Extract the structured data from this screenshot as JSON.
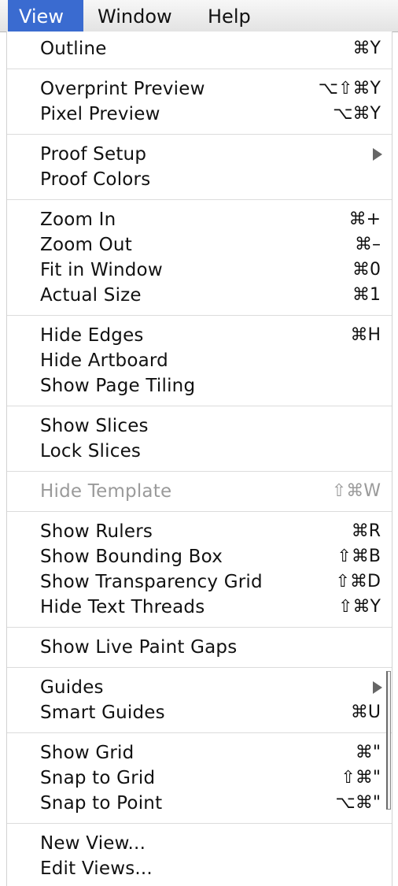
{
  "menubar": {
    "items": [
      {
        "label": "View",
        "active": true
      },
      {
        "label": "Window"
      },
      {
        "label": "Help"
      }
    ]
  },
  "menu": {
    "items": [
      {
        "label": "Outline",
        "shortcut": "⌘Y"
      },
      {
        "label": "Overprint Preview",
        "shortcut": "⌥⇧⌘Y"
      },
      {
        "label": "Pixel Preview",
        "shortcut": "⌥⌘Y"
      },
      {
        "label": "Proof Setup",
        "submenu": true
      },
      {
        "label": "Proof Colors",
        "shortcut": ""
      },
      {
        "label": "Zoom In",
        "shortcut": "⌘+"
      },
      {
        "label": "Zoom Out",
        "shortcut": "⌘–"
      },
      {
        "label": "Fit in Window",
        "shortcut": "⌘0"
      },
      {
        "label": "Actual Size",
        "shortcut": "⌘1"
      },
      {
        "label": "Hide Edges",
        "shortcut": "⌘H"
      },
      {
        "label": "Hide Artboard",
        "shortcut": ""
      },
      {
        "label": "Show Page Tiling",
        "shortcut": ""
      },
      {
        "label": "Show Slices",
        "shortcut": ""
      },
      {
        "label": "Lock Slices",
        "shortcut": ""
      },
      {
        "label": "Hide Template",
        "shortcut": "⇧⌘W",
        "disabled": true
      },
      {
        "label": "Show Rulers",
        "shortcut": "⌘R"
      },
      {
        "label": "Show Bounding Box",
        "shortcut": "⇧⌘B"
      },
      {
        "label": "Show Transparency Grid",
        "shortcut": "⇧⌘D"
      },
      {
        "label": "Hide Text Threads",
        "shortcut": "⇧⌘Y"
      },
      {
        "label": "Show Live Paint Gaps",
        "shortcut": ""
      },
      {
        "label": "Guides",
        "submenu": true
      },
      {
        "label": "Smart Guides",
        "shortcut": "⌘U"
      },
      {
        "label": "Show Grid",
        "shortcut": "⌘\""
      },
      {
        "label": "Snap to Grid",
        "shortcut": "⇧⌘\""
      },
      {
        "label": "Snap to Point",
        "shortcut": "⌥⌘\""
      },
      {
        "label": "New View...",
        "shortcut": ""
      },
      {
        "label": "Edit Views...",
        "shortcut": ""
      }
    ]
  }
}
